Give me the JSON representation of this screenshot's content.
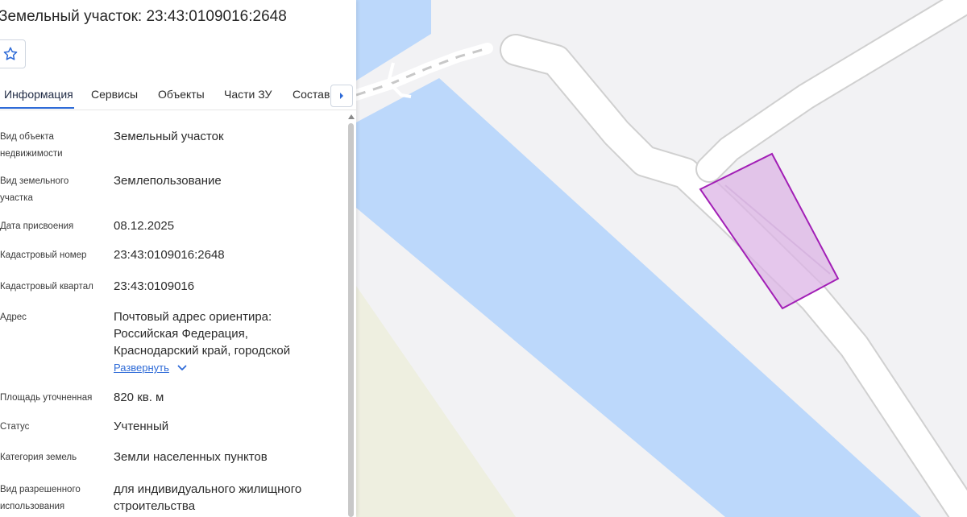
{
  "header": {
    "title": "Земельный участок: 23:43:0109016:2648",
    "favorite_icon": "star-outline-icon"
  },
  "tabs": [
    {
      "label": "Информация",
      "active": true
    },
    {
      "label": "Сервисы",
      "active": false
    },
    {
      "label": "Объекты",
      "active": false
    },
    {
      "label": "Части ЗУ",
      "active": false
    },
    {
      "label": "Состав",
      "active": false
    }
  ],
  "tabs_next_icon": "chevron-right-icon",
  "fields": [
    {
      "label": "Вид объекта недвижимости",
      "value": "Земельный участок"
    },
    {
      "label": "Вид земельного участка",
      "value": "Землепользование"
    },
    {
      "label": "Дата присвоения",
      "value": "08.12.2025"
    },
    {
      "label": "Кадастровый номер",
      "value": "23:43:0109016:2648"
    },
    {
      "label": "Кадастровый квартал",
      "value": "23:43:0109016"
    },
    {
      "label": "Адрес",
      "value": "Почтовый адрес ориентира: Российская Федерация, Краснодарский край, городской"
    },
    {
      "label": "Площадь уточненная",
      "value": "820 кв. м"
    },
    {
      "label": "Статус",
      "value": "Учтенный"
    },
    {
      "label": "Категория земель",
      "value": "Земли населенных пунктов"
    },
    {
      "label": "Вид разрешенного использования",
      "value": "для индивидуального жилищного строительства"
    }
  ],
  "address_expand": {
    "label": "Развернуть",
    "icon": "chevron-down-icon"
  },
  "colors": {
    "accent": "#2d6ad7",
    "map_background": "#f2f2f4",
    "water": "#bcd8fb",
    "sand": "#eeefe0",
    "road": "#ffffff",
    "parcel_fill": "#dcb4e6",
    "parcel_stroke": "#a21fb6"
  }
}
